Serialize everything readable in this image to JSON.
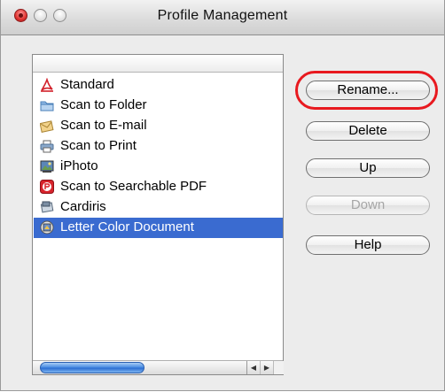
{
  "window": {
    "title": "Profile Management"
  },
  "profiles": [
    {
      "label": "Standard",
      "icon": "acrobat-pdf-icon",
      "selected": false
    },
    {
      "label": "Scan to Folder",
      "icon": "folder-icon",
      "selected": false
    },
    {
      "label": "Scan to E-mail",
      "icon": "email-icon",
      "selected": false
    },
    {
      "label": "Scan to Print",
      "icon": "printer-icon",
      "selected": false
    },
    {
      "label": "iPhoto",
      "icon": "iphoto-icon",
      "selected": false
    },
    {
      "label": "Scan to Searchable PDF",
      "icon": "searchable-pdf-icon",
      "selected": false
    },
    {
      "label": "Cardiris",
      "icon": "cardiris-icon",
      "selected": false
    },
    {
      "label": "Letter Color Document",
      "icon": "scanner-document-icon",
      "selected": true
    }
  ],
  "buttons": {
    "rename": "Rename...",
    "delete": "Delete",
    "up": "Up",
    "down": "Down",
    "help": "Help"
  },
  "buttons_enabled": {
    "rename": true,
    "delete": true,
    "up": true,
    "down": false,
    "help": true
  },
  "colors": {
    "selection": "#3a6bd0",
    "highlight_ring": "#e8191f"
  }
}
